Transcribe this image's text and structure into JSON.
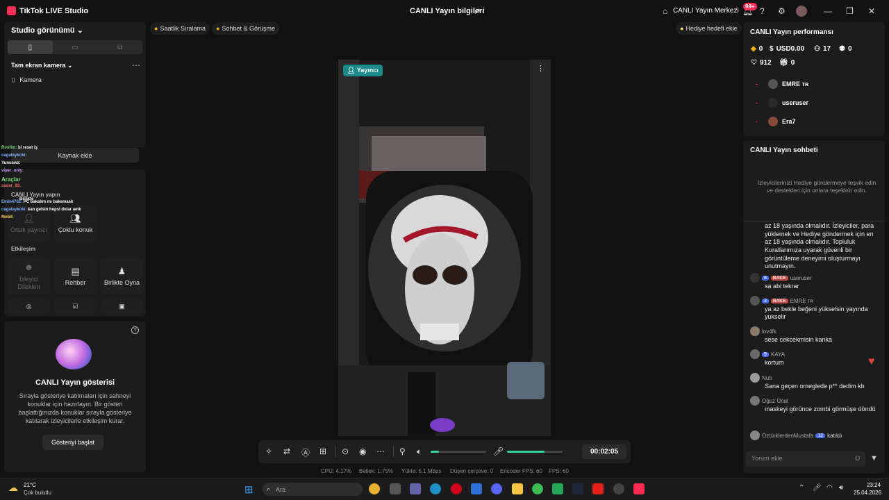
{
  "titlebar": {
    "app_name": "TikTok LIVE Studio",
    "live_info": "CANLI Yayın bilgileri",
    "live_center": "CANLI Yayın Merkezi",
    "notif_badge": "99+"
  },
  "left": {
    "studio_view": "Studio görünümü",
    "scene_name": "Tam ekran kamera",
    "camera_label": "Kamera",
    "add_source": "Kaynak ekle",
    "chat_overlay": [
      {
        "user": "Rostim:",
        "text": "bi reset iş"
      },
      {
        "user": "cagataykoki:",
        "text": ""
      },
      {
        "user": "Yunuswz:",
        "text": ""
      },
      {
        "user": "viper_only:",
        "text": ""
      },
      {
        "user": "Araçlar",
        "text": ""
      },
      {
        "user": "sucer_93:",
        "text": ""
      },
      {
        "user": "CANLI Yayın yapın",
        "text": ""
      },
      {
        "user": "Birlikte",
        "text": ""
      },
      {
        "user": "Emin4762:",
        "text": "PC bakalım mı bakemask"
      },
      {
        "user": "cagataykoki:",
        "text": "kan geisin hepsi dolar amk"
      },
      {
        "user": "Mobil:",
        "text": ""
      }
    ],
    "row1": [
      {
        "label": "Ortak yayıncı",
        "icon": "guest-icon",
        "dim": true
      },
      {
        "label": "Çoklu konuk",
        "icon": "multi-guest-icon",
        "dim": false
      }
    ],
    "interaction_title": "Etkileşim",
    "row2": [
      {
        "label": "İzleyici Dilekleri",
        "icon": "viewer-wishes-icon",
        "dim": true
      },
      {
        "label": "Rehber",
        "icon": "guide-icon",
        "dim": false
      },
      {
        "label": "Birlikte Oyna",
        "icon": "play-together-icon",
        "dim": false
      }
    ],
    "show": {
      "title": "CANLI Yayın gösterisi",
      "description": "Sırayla gösteriye katılmaları için sahneyi konuklar için hazırlayın. Bir gösteri başlattığınızda konuklar sırayla gösteriye katılarak izleyicilerle etkileşim kurar.",
      "button": "Gösteriyi başlat"
    }
  },
  "chips": {
    "hourly_rank": "Saatlik Sıralama",
    "chat_meet": "Sohbet & Görüşme",
    "gift_goal": "Hediye hedefi ekle"
  },
  "video": {
    "host_label": "Yayıncı"
  },
  "controls": {
    "timer": "00:02:05",
    "volume_level": 0.15,
    "mic_level": 0.68
  },
  "statusbar": {
    "cpu": "CPU: 4.17%",
    "memory": "Bellek: 1.75%",
    "upload": "Yükle: 5.1 Mbps",
    "dropped": "Düşen çerçeve: 0",
    "encoder_fps": "Encoder FPS: 60",
    "fps": "FPS: 60"
  },
  "performance": {
    "title": "CANLI Yayın performansı",
    "diamonds": "0",
    "usd": "USD0.00",
    "viewers": "17",
    "new_followers": "0",
    "likes": "912",
    "gifts": "0",
    "top_viewers": [
      {
        "rank": "-",
        "name": "EMRE ᴛʀ"
      },
      {
        "rank": "-",
        "name": "useruser"
      },
      {
        "rank": "-",
        "name": "Era7"
      }
    ]
  },
  "chat": {
    "title": "CANLI Yayın sohbeti",
    "hint": "İzleyicilerinizi Hediye göndermeye teşvik edin ve destekleri için onlara teşekkür edin.",
    "system_text": "az 18 yaşında olmalıdır. İzleyiciler, para yüklemek ve Hediye göndermek için en az 18 yaşında olmalıdır. Topluluk Kurallarımıza uyarak güvenli bir görüntüleme deneyimi oluşturmayı unutmayın.",
    "messages": [
      {
        "level": "8",
        "fan": "BAKE",
        "user": "useruser",
        "text": "sa abi tekrar"
      },
      {
        "level": "3",
        "fan": "BAKE",
        "user": "EMRE ᴛʀ",
        "text": "ya az bekle beğeni yükselsin yayında yukselir"
      },
      {
        "level": "",
        "fan": "",
        "user": "lov4fk",
        "text": "sese cekcekmisin kanka"
      },
      {
        "level": "9",
        "fan": "",
        "user": "KAYA",
        "text": "kortum"
      },
      {
        "level": "",
        "fan": "",
        "user": "Nuh",
        "text": "Sana geçen omeglede p** dedim kb"
      },
      {
        "level": "",
        "fan": "",
        "user": "Oğuz Ünal",
        "text": "maskeyi görünce zombi görmüşe döndü"
      }
    ],
    "join": {
      "user": "ÖztürklerdenMustafa",
      "level": "12",
      "action": "katıldı"
    },
    "input_placeholder": "Yorum ekle"
  },
  "taskbar": {
    "temp": "21°C",
    "weather": "Çok bulutlu",
    "search_placeholder": "Ara",
    "time": "23:24",
    "date": "25.04.2026"
  },
  "colors": {
    "accent": "#fe2c55",
    "bg": "#121212",
    "panel": "#1c1c1c"
  }
}
